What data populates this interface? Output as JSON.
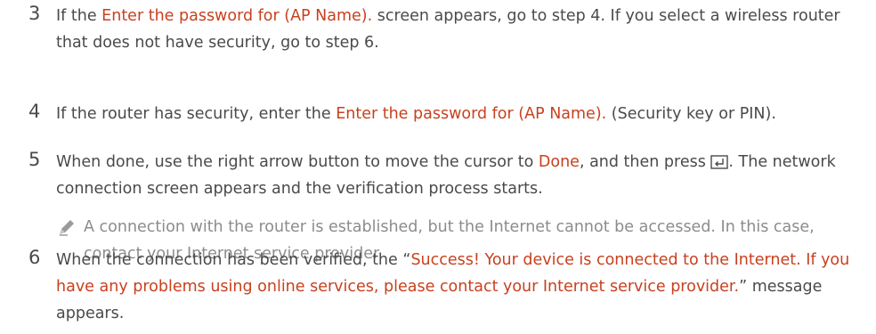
{
  "steps": [
    {
      "number": "3",
      "parts": [
        {
          "t": "If the "
        },
        {
          "t": "Enter the password for (AP Name).",
          "hl": true
        },
        {
          "t": " screen appears, go to step 4. If you select a wireless router that does not have security, go to step 6."
        }
      ]
    },
    {
      "number": "4",
      "parts": [
        {
          "t": "If the router has security, enter the "
        },
        {
          "t": "Enter the password for (AP Name).",
          "hl": true
        },
        {
          "t": " (Security key or PIN)."
        }
      ]
    },
    {
      "number": "5",
      "parts": [
        {
          "t": "When done, use the right arrow button to move the cursor to "
        },
        {
          "t": "Done",
          "hl": true
        },
        {
          "t": ", and then press "
        },
        {
          "icon": "enter-key-icon"
        },
        {
          "t": ". The network connection screen appears and the verification process starts."
        }
      ]
    },
    {
      "number": "6",
      "parts": [
        {
          "t": "When the connection has been verified, the “"
        },
        {
          "t": "Success! Your device is connected to the Internet. If you have any problems using online services, please contact your Internet service provider.",
          "hl": true
        },
        {
          "t": "” message appears."
        }
      ]
    }
  ],
  "note": {
    "icon": "pencil-note-icon",
    "text": "A connection with the router is established, but the Internet cannot be accessed. In this case, contact your Internet service provider."
  },
  "colors": {
    "highlight": "#c8411f",
    "body_text": "#4a4a4a",
    "note_text": "#8c8c8c"
  }
}
